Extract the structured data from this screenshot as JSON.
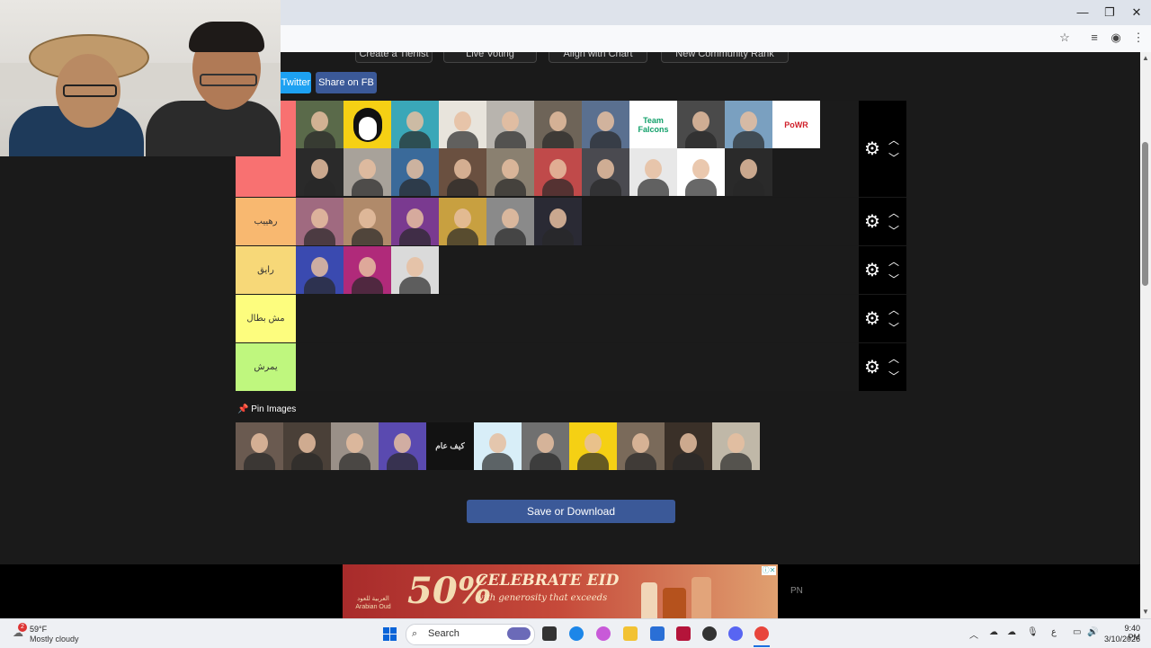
{
  "window": {
    "minimize": "—",
    "restore": "❐",
    "close": "✕"
  },
  "toolbar_icons": [
    "star-icon",
    "media-icon",
    "profile-icon",
    "menu-icon"
  ],
  "top_buttons": [
    "Create a Tierlist",
    "Live Voting",
    "Align with Chart",
    "New Community Rank"
  ],
  "share": {
    "twitter": "Twitter",
    "facebook": "Share on FB"
  },
  "tiers": [
    {
      "label": "",
      "color": "#f87171",
      "item_count": 21
    },
    {
      "label": "رهييب",
      "color": "#f8b870",
      "item_count": 6
    },
    {
      "label": "رايق",
      "color": "#f7d878",
      "item_count": 3
    },
    {
      "label": "مش بطال",
      "color": "#fdfd7e",
      "item_count": 0
    },
    {
      "label": "يمرش",
      "color": "#bff77e",
      "item_count": 0
    }
  ],
  "tier_items": [
    [
      {
        "bg": "#5a6a4a",
        "kind": "person"
      },
      {
        "bg": "#f5d014",
        "kind": "penguin"
      },
      {
        "bg": "#3aa7b8",
        "kind": "person"
      },
      {
        "bg": "#e8e4dc",
        "kind": "person"
      },
      {
        "bg": "#b8b4ae",
        "kind": "person"
      },
      {
        "bg": "#6e6458",
        "kind": "person"
      },
      {
        "bg": "#5a7090",
        "kind": "person"
      },
      {
        "bg": "#ffffff",
        "kind": "text",
        "text": "Team Falcons",
        "color": "#12a06a"
      },
      {
        "bg": "#4a4a4a",
        "kind": "person"
      },
      {
        "bg": "#7aa0c0",
        "kind": "person"
      },
      {
        "bg": "#ffffff",
        "kind": "text",
        "text": "PoWR",
        "color": "#d0202a"
      },
      {
        "bg": "#2a2a2a",
        "kind": "person"
      },
      {
        "bg": "#a8a29a",
        "kind": "person"
      },
      {
        "bg": "#3a6a9a",
        "kind": "person"
      },
      {
        "bg": "#6a5040",
        "kind": "person"
      },
      {
        "bg": "#8a8070",
        "kind": "person"
      },
      {
        "bg": "#c04a4a",
        "kind": "person"
      },
      {
        "bg": "#4a4a50",
        "kind": "person"
      },
      {
        "bg": "#e8e8e8",
        "kind": "person"
      },
      {
        "bg": "#ffffff",
        "kind": "person"
      },
      {
        "bg": "#2a2a2a",
        "kind": "person"
      }
    ],
    [
      {
        "bg": "#a06a80",
        "kind": "person"
      },
      {
        "bg": "#b08a6a",
        "kind": "person"
      },
      {
        "bg": "#7a3a90",
        "kind": "person"
      },
      {
        "bg": "#c8a040",
        "kind": "person"
      },
      {
        "bg": "#8a8a8a",
        "kind": "person"
      },
      {
        "bg": "#2a2a34",
        "kind": "person"
      }
    ],
    [
      {
        "bg": "#3a4ab0",
        "kind": "person"
      },
      {
        "bg": "#b02a7a",
        "kind": "person"
      },
      {
        "bg": "#dadada",
        "kind": "person"
      }
    ],
    [],
    []
  ],
  "pin": {
    "title": "Pin Images",
    "icon": "📌"
  },
  "pin_images": [
    {
      "bg": "#6a5a50",
      "kind": "person"
    },
    {
      "bg": "#4a4038",
      "kind": "person"
    },
    {
      "bg": "#9a9088",
      "kind": "person"
    },
    {
      "bg": "#5a4ab0",
      "kind": "person"
    },
    {
      "bg": "#121212",
      "kind": "text",
      "text": "كيف عام",
      "color": "#dddddd"
    },
    {
      "bg": "#d8eef8",
      "kind": "person"
    },
    {
      "bg": "#707070",
      "kind": "person"
    },
    {
      "bg": "#f5d014",
      "kind": "person"
    },
    {
      "bg": "#7a6a5a",
      "kind": "person"
    },
    {
      "bg": "#3a3028",
      "kind": "person"
    },
    {
      "bg": "#c0b8a8",
      "kind": "person"
    }
  ],
  "save_button": "Save or Download",
  "ad": {
    "percent": "50%",
    "title": "CELEBRATE EID",
    "subtitle": "with generosity that exceeds",
    "brand": "العربية للعود Arabian Oud",
    "close": "ⓘ✕"
  },
  "pn": "PN",
  "taskbar": {
    "weather_temp": "59°F",
    "weather_desc": "Mostly cloudy",
    "weather_badge": "2",
    "search": "Search",
    "time": "9:40 PM",
    "date": "3/10/2026",
    "lang": "ع"
  }
}
